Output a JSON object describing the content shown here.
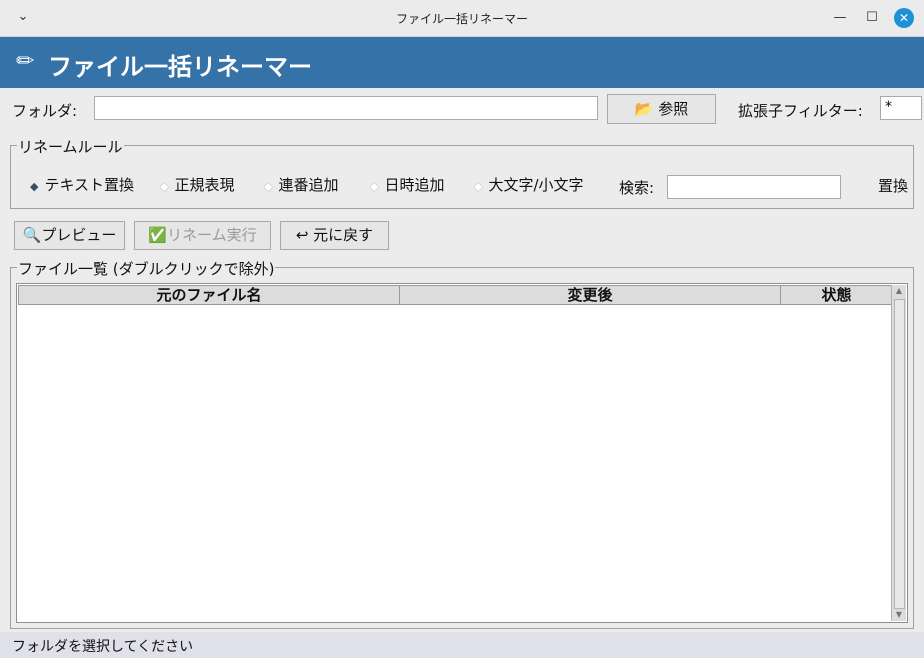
{
  "window": {
    "title": "ファイル一括リネーマー",
    "menu_glyph": "⌄",
    "minimize_glyph": "—",
    "maximize_glyph": "☐",
    "close_glyph": "✕"
  },
  "header": {
    "icon": "✏",
    "title": "ファイル一括リネーマー"
  },
  "folder": {
    "label": "フォルダ:",
    "value": "",
    "browse_icon": "📂",
    "browse_label": "参照",
    "filter_label": "拡張子フィルター:",
    "filter_value": "*"
  },
  "rules": {
    "title": "リネームルール",
    "options": [
      {
        "label": "テキスト置換",
        "selected": true
      },
      {
        "label": "正規表現",
        "selected": false
      },
      {
        "label": "連番追加",
        "selected": false
      },
      {
        "label": "日時追加",
        "selected": false
      },
      {
        "label": "大文字/小文字",
        "selected": false
      }
    ],
    "search_label": "検索:",
    "search_value": "",
    "overflow_text": "置換"
  },
  "actions": {
    "preview_icon": "🔍",
    "preview_label": "プレビュー",
    "execute_icon": "✅",
    "execute_label": "リネーム実行",
    "undo_icon": "↩",
    "undo_label": "元に戻す"
  },
  "file_list": {
    "title": "ファイル一覧 (ダブルクリックで除外)",
    "columns": [
      "元のファイル名",
      "変更後",
      "状態"
    ],
    "rows": []
  },
  "status": {
    "text": "フォルダを選択してください"
  }
}
